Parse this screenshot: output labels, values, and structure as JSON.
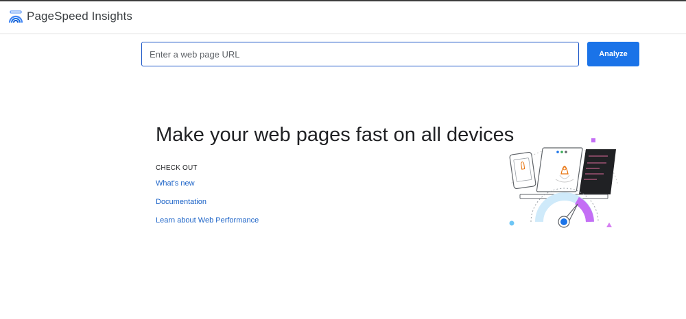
{
  "header": {
    "title": "PageSpeed Insights",
    "logo_icon": "pagespeed-gauge-icon"
  },
  "search": {
    "placeholder": "Enter a web page URL",
    "value": "",
    "analyze_label": "Analyze"
  },
  "main": {
    "headline": "Make your web pages fast on all devices",
    "checkout_label": "CHECK OUT",
    "links": [
      {
        "label": "What's new"
      },
      {
        "label": "Documentation"
      },
      {
        "label": "Learn about Web Performance"
      }
    ],
    "illustration_icon": "speed-gauge-rocket-illustration"
  },
  "colors": {
    "accent": "#1a73e8",
    "link": "#1a62c7",
    "input_border": "#1a55c7",
    "illustration_purple": "#c46ef5",
    "illustration_blue": "#1a73e8",
    "illustration_light_blue": "#cfeafa"
  }
}
